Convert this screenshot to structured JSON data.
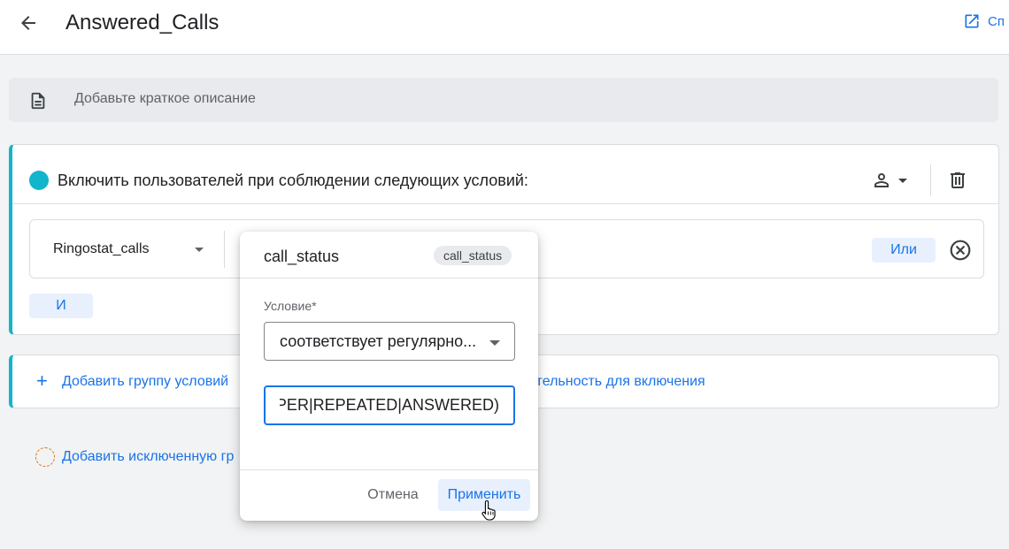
{
  "header": {
    "title": "Answered_Calls",
    "external_label": "Сп"
  },
  "description": {
    "placeholder": "Добавьте краткое описание"
  },
  "include_group": {
    "title": "Включить пользователей при соблюдении следующих условий:",
    "condition": {
      "dimension": "Ringostat_calls",
      "or_label": "Или"
    },
    "and_label": "И"
  },
  "add_card": {
    "add_group_label": "Добавить группу условий",
    "add_sequence_label": "ательность для включения"
  },
  "excluded": {
    "label": "Добавить исключенную гр"
  },
  "popup": {
    "title": "call_status",
    "chip": "call_status",
    "condition_label": "Условие*",
    "condition_value": "соответствует регулярно...",
    "value": "(PROPER|REPEATED|ANSWERED)",
    "cancel_label": "Отмена",
    "apply_label": "Применить"
  },
  "icons": {
    "back": "arrow-left-icon",
    "external": "open-in-new-icon",
    "document": "document-icon",
    "person": "person-icon",
    "trash": "trash-icon",
    "remove": "close-circle-icon",
    "plus": "plus-icon",
    "cursor": "hand-pointer-icon"
  },
  "colors": {
    "accent": "#1a73e8",
    "teal": "#12b5cb",
    "chip_bg": "#e8f0fe",
    "excluded_ring": "#e8710a"
  }
}
